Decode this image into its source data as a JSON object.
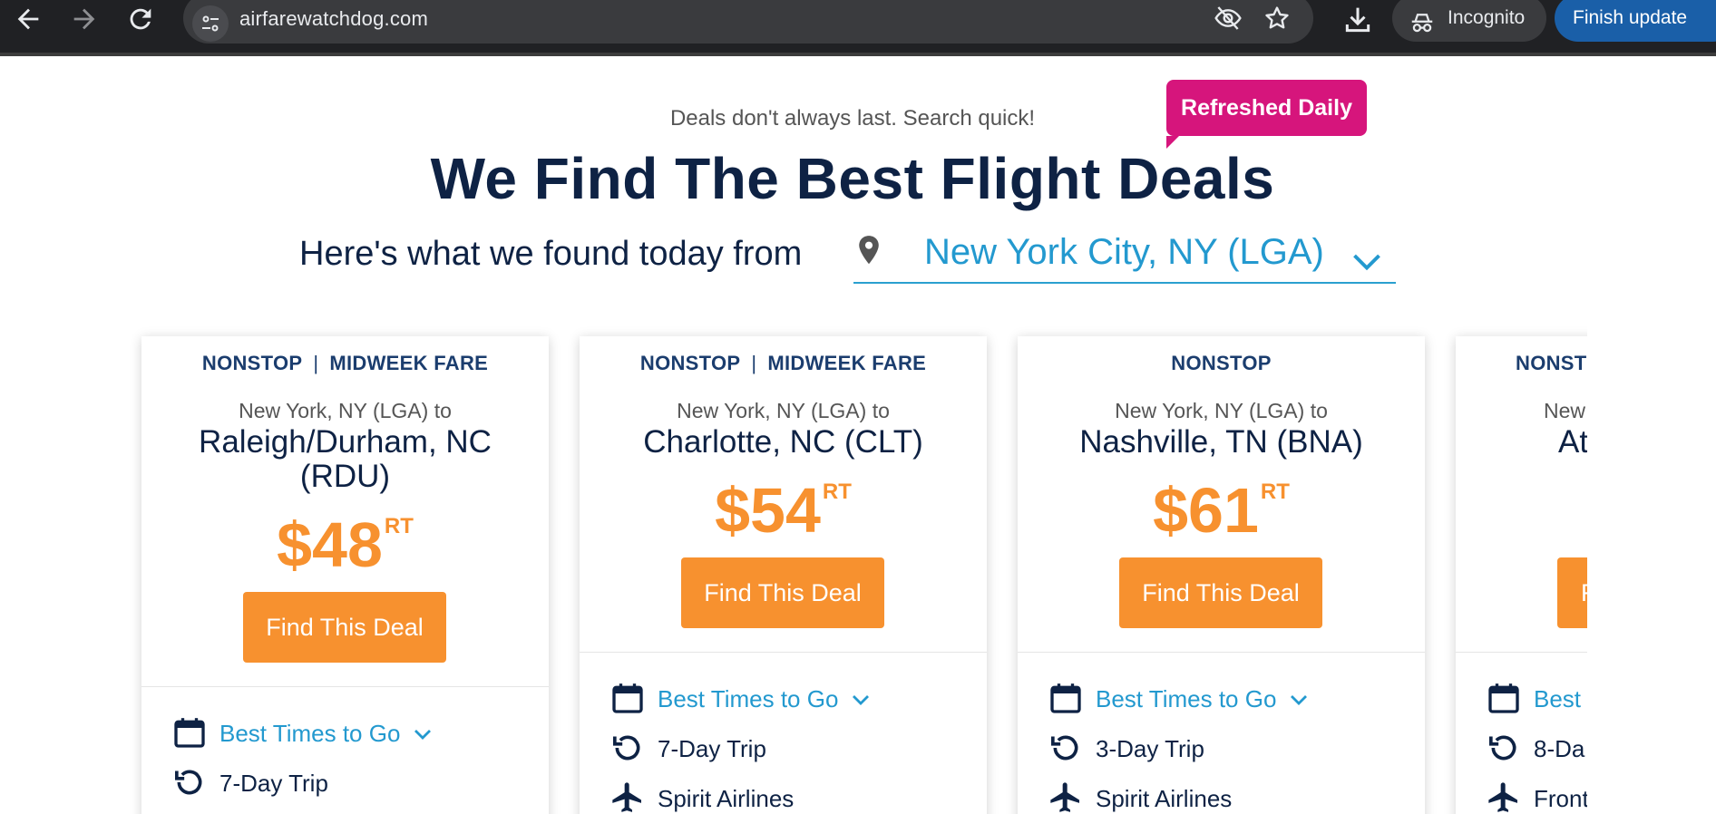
{
  "browser": {
    "url": "airfarewatchdog.com",
    "incognito_label": "Incognito",
    "finish_update_label": "Finish update"
  },
  "hero": {
    "tagline": "Deals don't always last. Search quick!",
    "badge": "Refreshed Daily",
    "headline": "We Find The Best Flight Deals",
    "found_text": "Here's what we found today from",
    "origin_city": "New York City, NY (LGA)"
  },
  "cards": [
    {
      "tag1": "NONSTOP",
      "tag2": "MIDWEEK FARE",
      "from": "New York, NY (LGA) to",
      "dest": "Raleigh/Durham, NC (RDU)",
      "price": "$48",
      "price_suffix": "RT",
      "button": "Find This Deal",
      "best_times": "Best Times to Go",
      "trip": "7-Day Trip",
      "airline": ""
    },
    {
      "tag1": "NONSTOP",
      "tag2": "MIDWEEK FARE",
      "from": "New York, NY (LGA) to",
      "dest": "Charlotte, NC (CLT)",
      "price": "$54",
      "price_suffix": "RT",
      "button": "Find This Deal",
      "best_times": "Best Times to Go",
      "trip": "7-Day Trip",
      "airline": "Spirit Airlines"
    },
    {
      "tag1": "NONSTOP",
      "tag2": "",
      "from": "New York, NY (LGA) to",
      "dest": "Nashville, TN (BNA)",
      "price": "$61",
      "price_suffix": "RT",
      "button": "Find This Deal",
      "best_times": "Best Times to Go",
      "trip": "3-Day Trip",
      "airline": "Spirit Airlines"
    },
    {
      "tag1": "NONST",
      "tag2": "",
      "from": "New",
      "dest": "Atla",
      "price": "",
      "price_suffix": "",
      "button": "F",
      "best_times": "Best",
      "trip": "8-Da",
      "airline": "Front"
    }
  ],
  "colors": {
    "accent_orange": "#f7912f",
    "badge_pink": "#d6157c",
    "link_blue": "#2399cf",
    "navy": "#0e2244"
  }
}
